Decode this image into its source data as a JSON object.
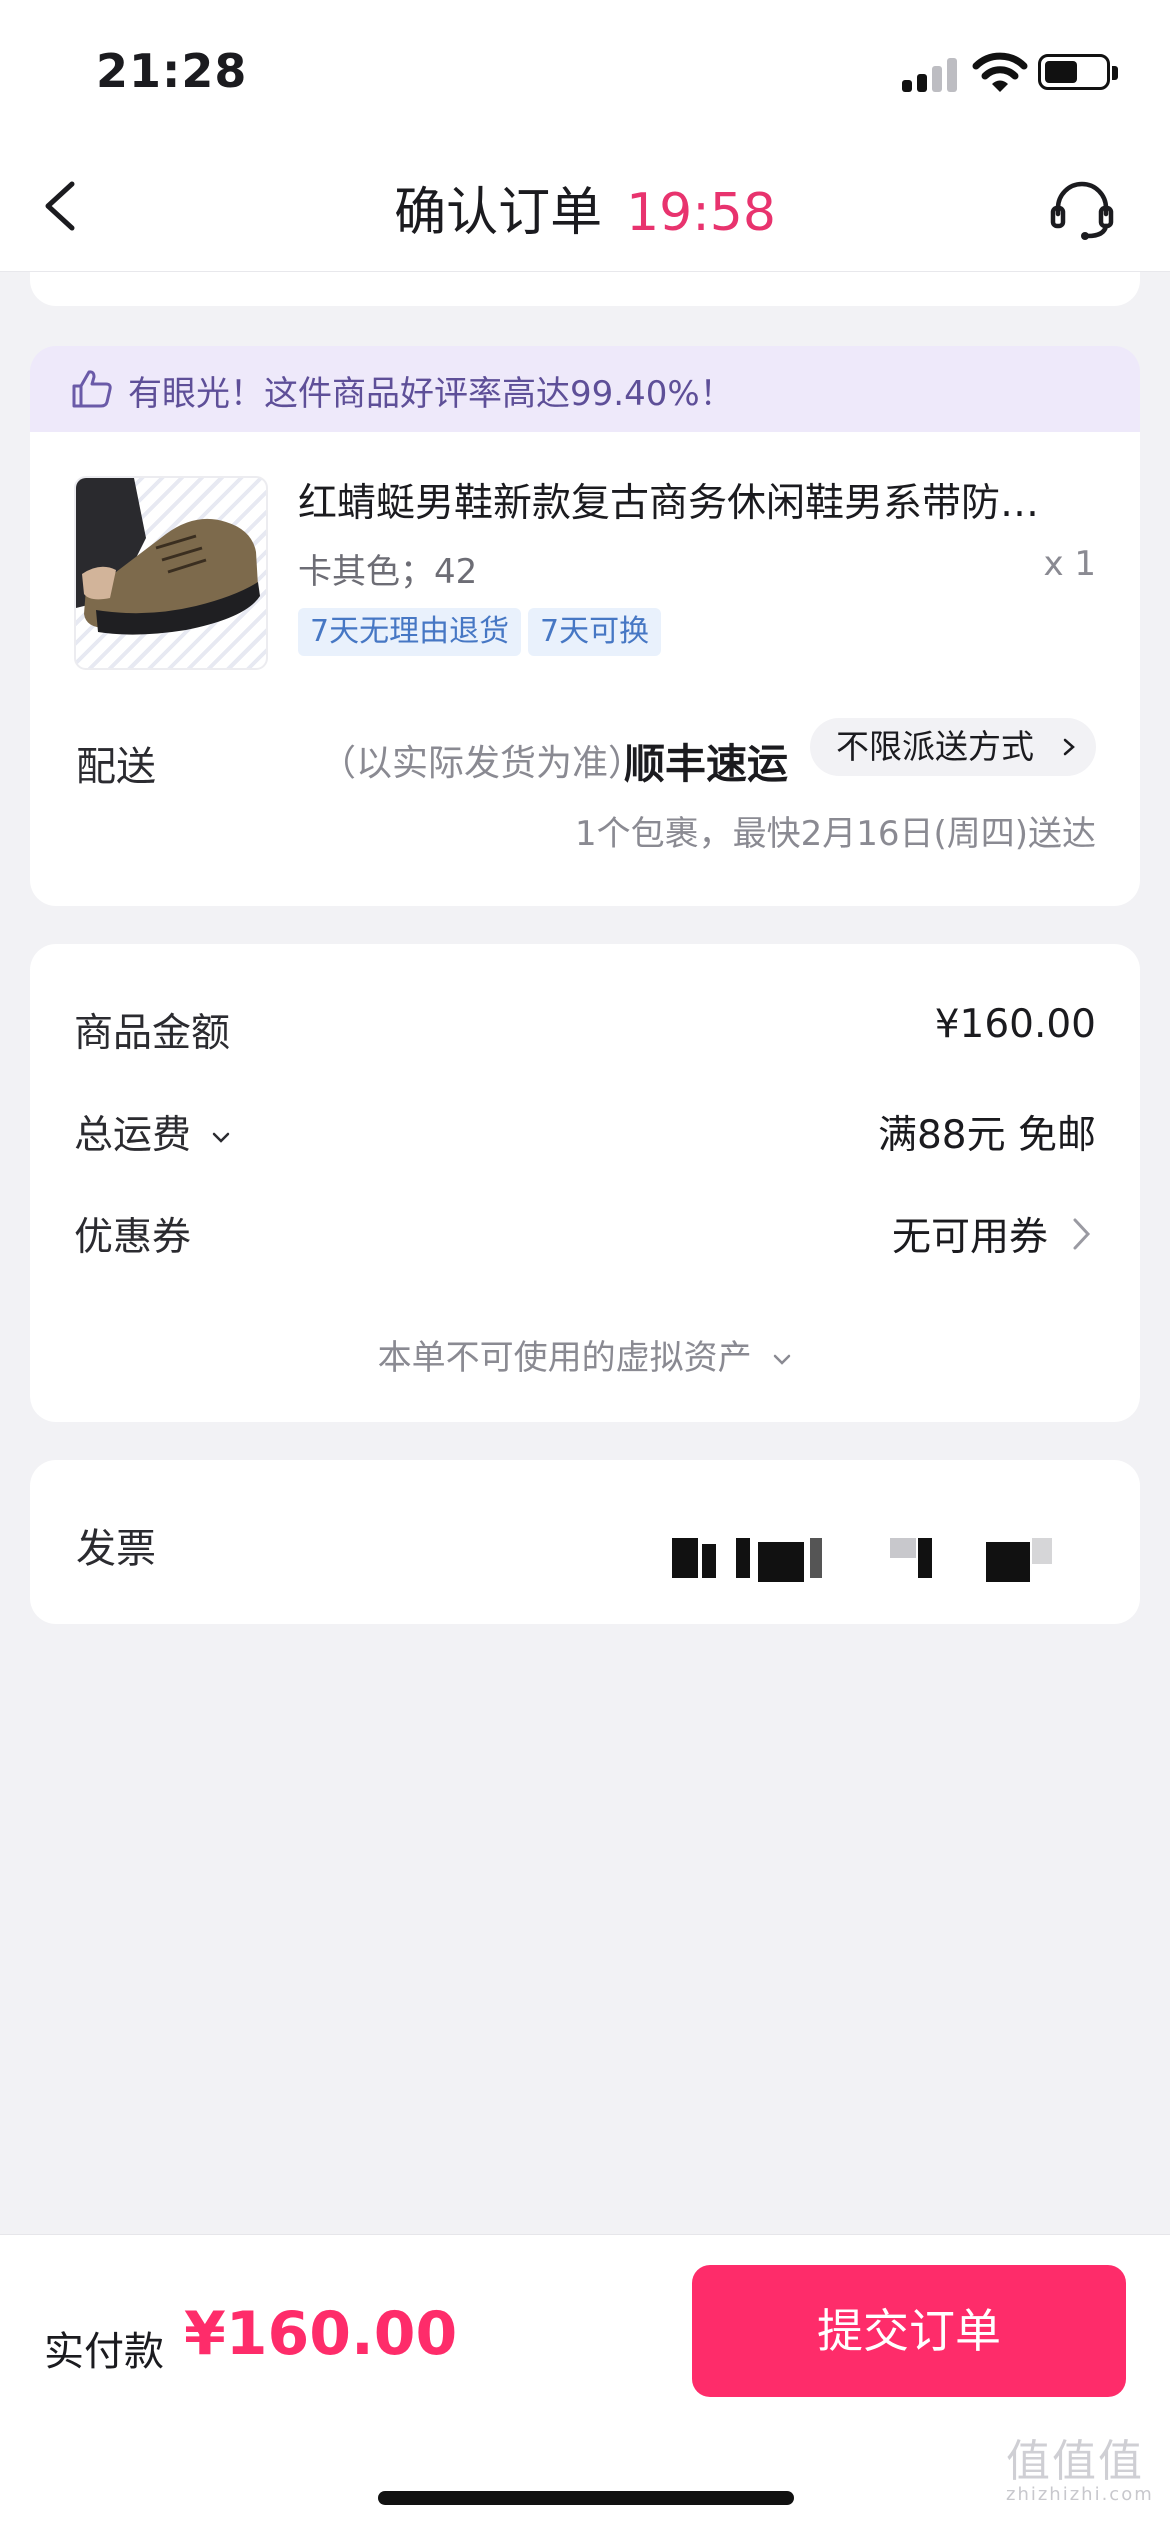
{
  "status_bar": {
    "time": "21:28"
  },
  "nav": {
    "title": "确认订单",
    "timer": "19:58"
  },
  "banner": {
    "text": "有眼光！这件商品好评率高达99.40%！"
  },
  "product": {
    "title": "红蜻蜓男鞋新款复古商务休闲鞋男系带防…",
    "spec": "卡其色；42",
    "quantity": "x 1",
    "tags": [
      "7天无理由退货",
      "7天可换"
    ]
  },
  "shipping": {
    "label": "配送",
    "note": "（以实际发货为准）",
    "carrier": "顺丰速运",
    "method": "不限派送方式",
    "eta": "1个包裹，最快2月16日(周四)送达"
  },
  "pricing": {
    "goods_label": "商品金额",
    "goods_value": "¥160.00",
    "freight_label": "总运费",
    "freight_value": "满88元 免邮",
    "coupon_label": "优惠券",
    "coupon_value": "无可用券",
    "virtual_assets": "本单不可使用的虚拟资产"
  },
  "invoice": {
    "label": "发票"
  },
  "footer": {
    "pay_label": "实付款",
    "pay_amount": "¥160.00",
    "submit_label": "提交订单"
  },
  "watermark": {
    "logo": "值值值",
    "sub": "zhizhizhi.com"
  },
  "colors": {
    "accent": "#fe2c6a",
    "timer": "#e8336e",
    "banner_bg": "#eee9fa",
    "banner_text": "#5e4f98",
    "tag_text": "#4677c4",
    "tag_bg": "#e9f1fc"
  }
}
